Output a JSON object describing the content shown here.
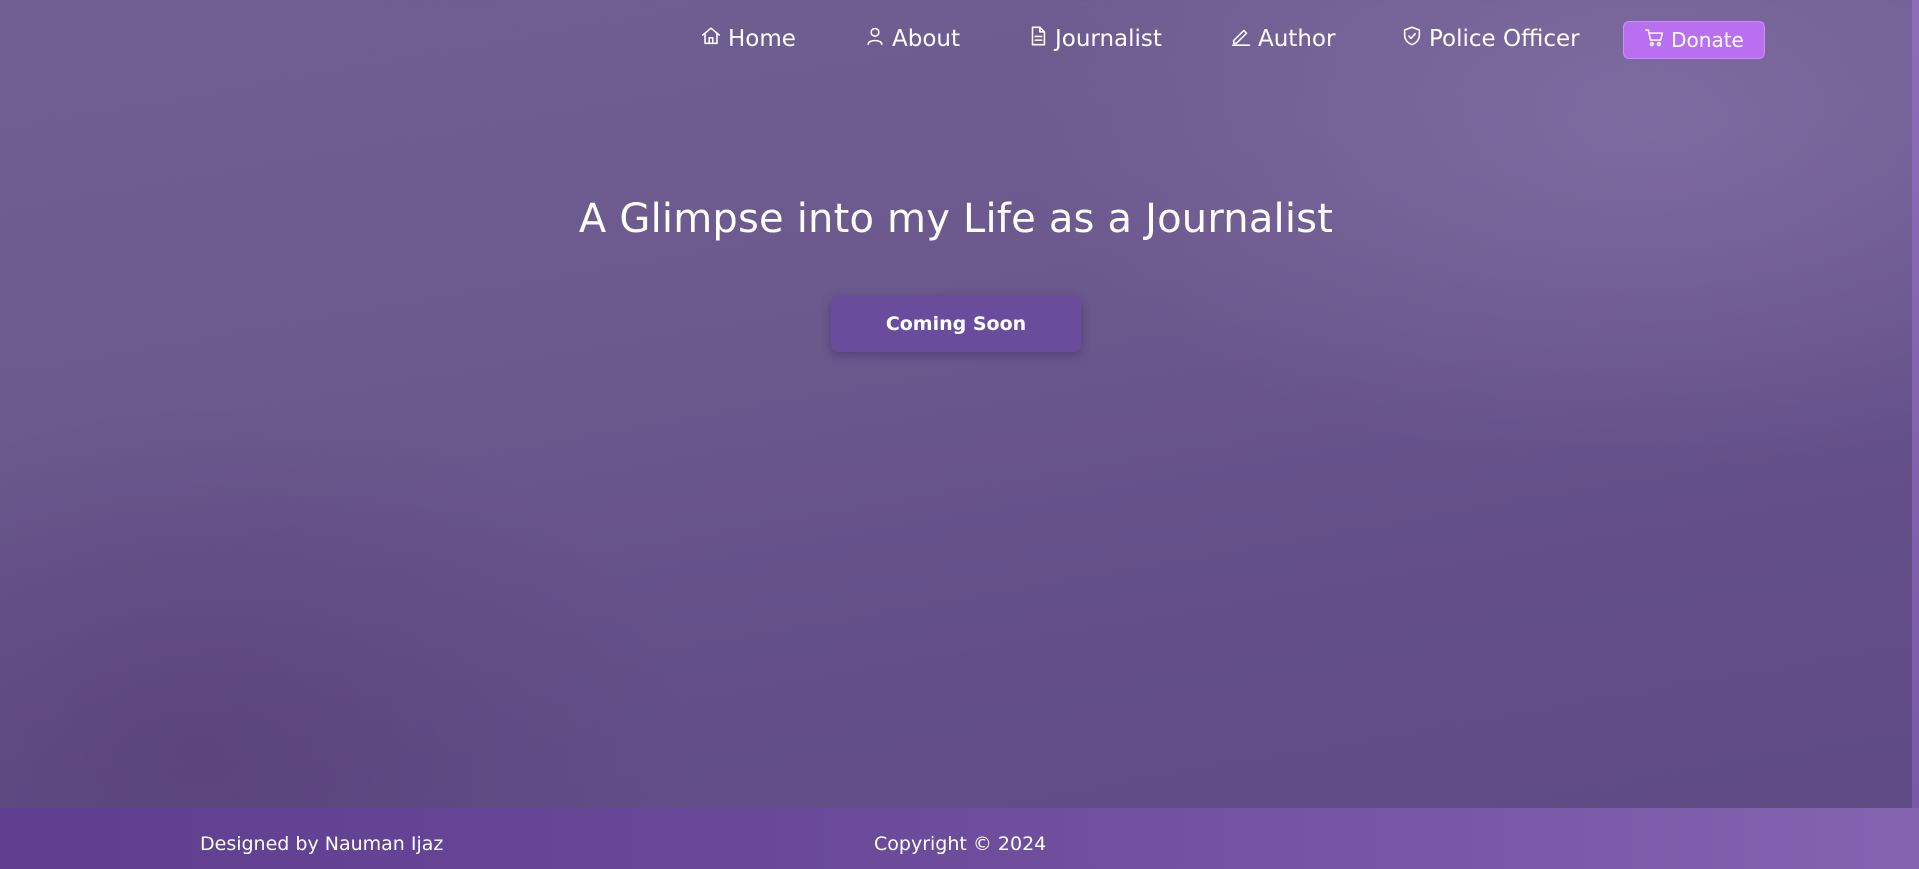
{
  "nav": {
    "items": [
      {
        "label": "Home",
        "icon": "home-icon"
      },
      {
        "label": "About",
        "icon": "user-icon"
      },
      {
        "label": "Journalist",
        "icon": "document-icon"
      },
      {
        "label": "Author",
        "icon": "pencil-icon"
      },
      {
        "label": "Police Officer",
        "icon": "shield-icon"
      }
    ],
    "donate": {
      "label": "Donate",
      "icon": "cart-icon"
    }
  },
  "hero": {
    "title": "A Glimpse into my Life as a Journalist",
    "button_label": "Coming Soon"
  },
  "footer": {
    "designed_by": "Designed by Nauman Ijaz",
    "copyright": "Copyright © 2024"
  },
  "colors": {
    "background": "#6c5a8e",
    "donate_button": "#b96ff0",
    "coming_soon_button": "#6a4c9c",
    "footer": "#6b4a9a",
    "text": "#ffffff"
  }
}
